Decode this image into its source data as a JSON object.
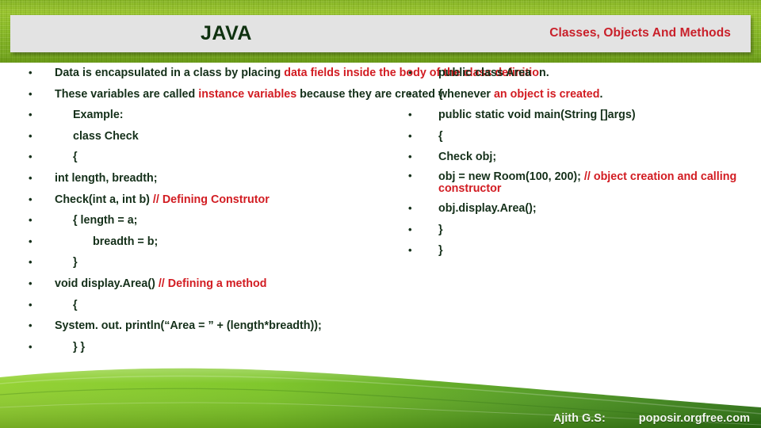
{
  "header": {
    "title": "JAVA",
    "subtitle": "Classes, Objects And Methods",
    "title_color": "#0f3110",
    "subtitle_color": "#c9202a",
    "panel_color": "#e3e3e3"
  },
  "theme": {
    "text_color": "#15301a",
    "accent_red": "#d21c22",
    "grass_green": "#8dc41c",
    "hill_green": "#6eb82a"
  },
  "bullet_glyph": "•",
  "left_column": [
    {
      "indent": 0,
      "parts": [
        {
          "t": "Data is encapsulated in a class by placing ",
          "c": "dark"
        },
        {
          "t": "data fields inside the body of the class definitio",
          "c": "red"
        },
        {
          "t": "n.",
          "c": "dark"
        }
      ]
    },
    {
      "indent": 0,
      "parts": [
        {
          "t": "These variables are called ",
          "c": "dark"
        },
        {
          "t": "instance variables",
          "c": "red"
        },
        {
          "t": " because they are created whenever ",
          "c": "dark"
        },
        {
          "t": "an object is created",
          "c": "red"
        },
        {
          "t": ".",
          "c": "dark"
        }
      ]
    },
    {
      "indent": 1,
      "parts": [
        {
          "t": "Example:",
          "c": "dark"
        }
      ]
    },
    {
      "indent": 1,
      "parts": [
        {
          "t": "class Check",
          "c": "dark"
        }
      ]
    },
    {
      "indent": 1,
      "parts": [
        {
          "t": "{",
          "c": "dark"
        }
      ]
    },
    {
      "indent": 0,
      "parts": [
        {
          "t": "int  length, breadth;",
          "c": "dark"
        }
      ]
    },
    {
      "indent": 0,
      "parts": [
        {
          "t": "Check(int a, int b) ",
          "c": "dark"
        },
        {
          "t": "// Defining Construtor",
          "c": "red"
        }
      ]
    },
    {
      "indent": 1,
      "parts": [
        {
          "t": "{        length = a;",
          "c": "dark"
        }
      ]
    },
    {
      "indent": 2,
      "parts": [
        {
          "t": "breadth = b;",
          "c": "dark"
        }
      ]
    },
    {
      "indent": 1,
      "parts": [
        {
          "t": "}",
          "c": "dark"
        }
      ]
    },
    {
      "indent": 0,
      "parts": [
        {
          "t": "void display.Area() ",
          "c": "dark"
        },
        {
          "t": "// Defining a method",
          "c": "red"
        }
      ]
    },
    {
      "indent": 1,
      "parts": [
        {
          "t": "{",
          "c": "dark"
        }
      ]
    },
    {
      "indent": 0,
      "parts": [
        {
          "t": "System. out. println(“Area = ” + (length*breadth));",
          "c": "dark"
        }
      ]
    },
    {
      "indent": 1,
      "parts": [
        {
          "t": "}   }",
          "c": "dark"
        }
      ]
    }
  ],
  "right_column": [
    {
      "indent": 1,
      "wrap": false,
      "parts": [
        {
          "t": "public class Area",
          "c": "dark"
        }
      ]
    },
    {
      "indent": 1,
      "wrap": false,
      "parts": [
        {
          "t": "{",
          "c": "dark"
        }
      ]
    },
    {
      "indent": 1,
      "wrap": false,
      "parts": [
        {
          "t": "public static void main(String []args)",
          "c": "dark"
        }
      ]
    },
    {
      "indent": 1,
      "wrap": false,
      "parts": [
        {
          "t": "{",
          "c": "dark"
        }
      ]
    },
    {
      "indent": 1,
      "wrap": false,
      "parts": [
        {
          "t": "Check obj;",
          "c": "dark"
        }
      ]
    },
    {
      "indent": 1,
      "wrap": true,
      "parts": [
        {
          "t": "obj = new Room(100, 200); ",
          "c": "dark"
        },
        {
          "t": "// object creation and calling constructor",
          "c": "red"
        }
      ]
    },
    {
      "indent": 1,
      "wrap": false,
      "parts": [
        {
          "t": "obj.display.Area();",
          "c": "dark"
        }
      ]
    },
    {
      "indent": 1,
      "wrap": false,
      "parts": [
        {
          "t": "}",
          "c": "dark"
        }
      ]
    },
    {
      "indent": 1,
      "wrap": false,
      "parts": [
        {
          "t": "}",
          "c": "dark"
        }
      ]
    }
  ],
  "footer": {
    "author": "Ajith G.S:",
    "website": "poposir.orgfree.com"
  }
}
